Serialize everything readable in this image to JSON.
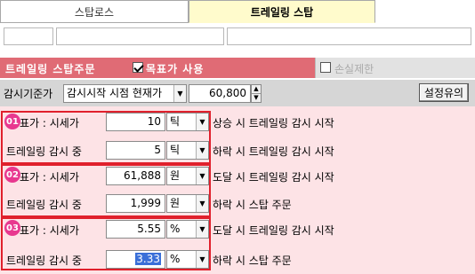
{
  "tabs": [
    {
      "label": "스탑로스",
      "active": false
    },
    {
      "label": "트레일링 스탑",
      "active": true
    }
  ],
  "header": {
    "title": "트레일링 스탑주문",
    "target_checkbox_label": "목표가 사용",
    "target_checked": true,
    "loss_limit_label": "손실제한",
    "loss_limit_checked": false
  },
  "monitor": {
    "label": "감시기준가",
    "combo_value": "감시시작 시점 현재가",
    "value": "60,800",
    "settings_button": "설정유의"
  },
  "groups": [
    {
      "badge": "01",
      "target_label": "표가 : 시세가",
      "target_value": "10",
      "target_unit": "틱",
      "target_desc": "상승 시 트레일링 감시 시작",
      "trail_label": "트레일링 감시 중",
      "trail_value": "5",
      "trail_unit": "틱",
      "trail_desc": "하락 시 트레일링 감시 시작"
    },
    {
      "badge": "02",
      "target_label": "표가 : 시세가",
      "target_value": "61,888",
      "target_unit": "원",
      "target_desc": "도달 시 트레일링 감시 시작",
      "trail_label": "트레일링 감시 중",
      "trail_value": "1,999",
      "trail_unit": "원",
      "trail_desc": "하락 시 스탑 주문"
    },
    {
      "badge": "03",
      "target_label": "표가 : 시세가",
      "target_value": "5.55",
      "target_unit": "%",
      "target_desc": "도달 시 트레일링 감시 시작",
      "trail_label": "트레일링 감시 중",
      "trail_value": "3.33",
      "trail_unit": "%",
      "trail_desc": "하락 시 스탑 주문"
    }
  ],
  "colors": {
    "header_bar": "#e06b75",
    "panel_bg": "#fde3e6",
    "group_border": "#e0202c",
    "badge": "#e8388f",
    "active_tab": "#fffbcc"
  }
}
